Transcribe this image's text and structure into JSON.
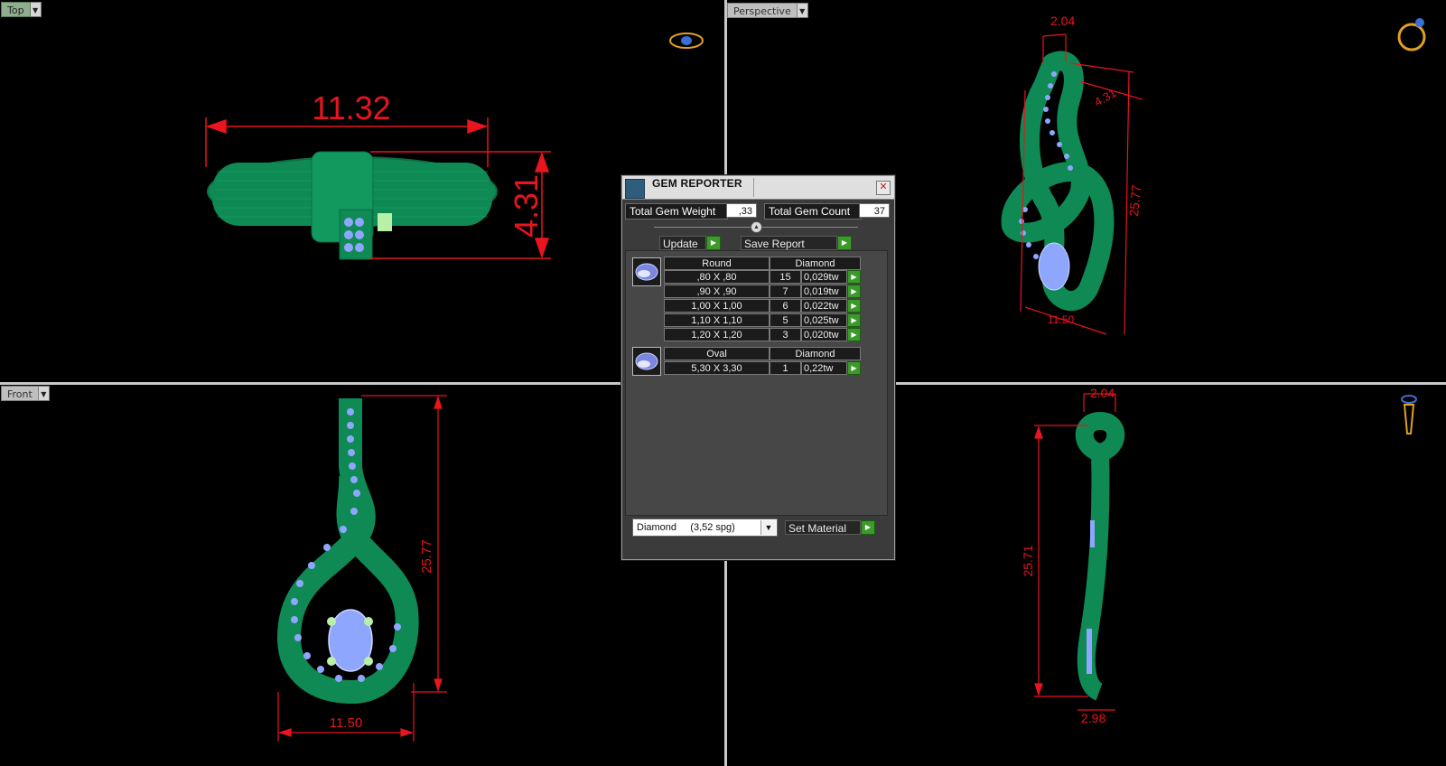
{
  "viewports": {
    "top": {
      "label": "Top",
      "dim_width": "11.32",
      "dim_height": "4.31"
    },
    "perspective": {
      "label": "Perspective",
      "dim_top": "2.04",
      "dim_side": "4.31",
      "dim_height": "25.77",
      "dim_bottom": "11.50"
    },
    "front": {
      "label": "Front",
      "dim_height": "25.77",
      "dim_width": "11.50"
    },
    "right": {
      "dim_top": "2.04",
      "dim_height": "25.71",
      "dim_bottom": "2.98"
    }
  },
  "gem_reporter": {
    "title": "GEM REPORTER",
    "total_weight_label": "Total Gem Weight",
    "total_weight_value": ",33",
    "total_count_label": "Total Gem Count",
    "total_count_value": "37",
    "update_label": "Update",
    "save_report_label": "Save Report",
    "groups": [
      {
        "shape": "Round",
        "material": "Diamond",
        "rows": [
          {
            "size": ",80 X ,80",
            "count": "15",
            "weight": "0,029tw"
          },
          {
            "size": ",90 X ,90",
            "count": "7",
            "weight": "0,019tw"
          },
          {
            "size": "1,00 X 1,00",
            "count": "6",
            "weight": "0,022tw"
          },
          {
            "size": "1,10 X 1,10",
            "count": "5",
            "weight": "0,025tw"
          },
          {
            "size": "1,20 X 1,20",
            "count": "3",
            "weight": "0,020tw"
          }
        ]
      },
      {
        "shape": "Oval",
        "material": "Diamond",
        "rows": [
          {
            "size": "5,30 X 3,30",
            "count": "1",
            "weight": "0,22tw"
          }
        ]
      }
    ],
    "material_select_value": "Diamond     (3,52 spg)",
    "set_material_label": "Set Material"
  },
  "colors": {
    "model_green": "#0f8a55",
    "gem_blue": "#8fa6ff",
    "dimension_red": "#e8141e",
    "accent_green_button": "#3c9a2a"
  }
}
